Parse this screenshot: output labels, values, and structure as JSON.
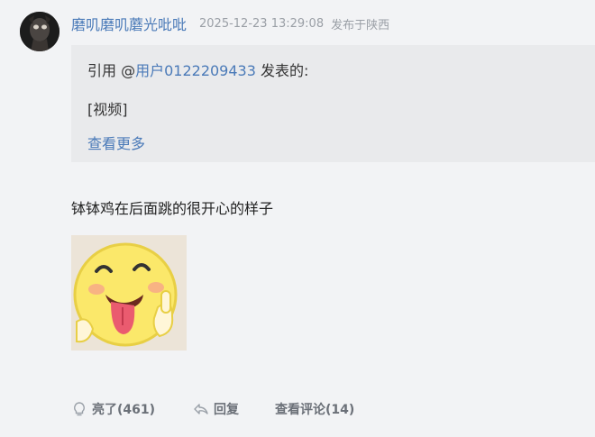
{
  "post": {
    "username": "磨叽磨叽蘑光吡吡",
    "timestamp": "2025-12-23 13:29:08",
    "location": "发布于陕西",
    "quote": {
      "prefix": "引用 @",
      "user": "用户0122209433",
      "suffix": " 发表的:",
      "content": "[视频]",
      "more_label": "查看更多"
    },
    "text": "钵钵鸡在后面跳的很开心的样子",
    "actions": {
      "like_label": "亮了(461)",
      "reply_label": "回复",
      "comments_label": "查看评论(14)"
    }
  },
  "icons": {
    "like": "lightbulb-icon",
    "reply": "reply-arrow-icon"
  },
  "colors": {
    "link": "#4a7ab8",
    "meta": "#9a9fa6",
    "quote_bg": "#e9eaec",
    "page_bg": "#f2f3f5"
  }
}
